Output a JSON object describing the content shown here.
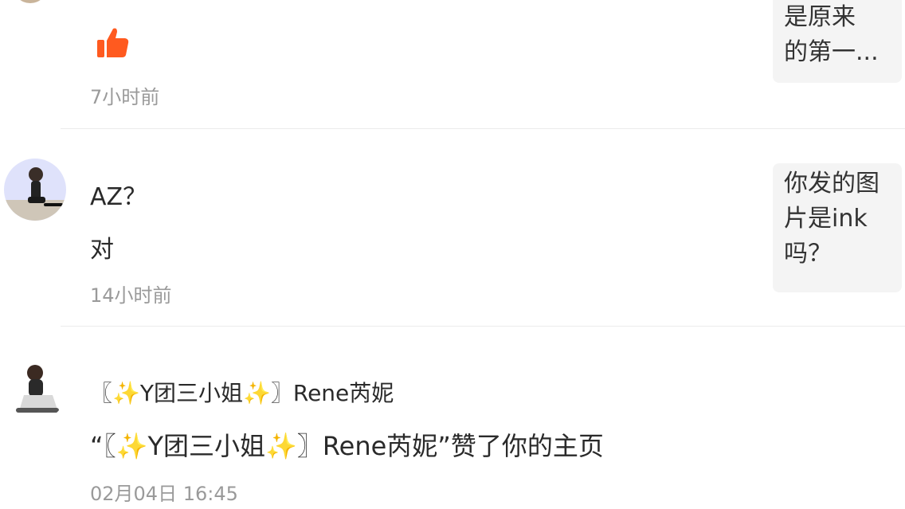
{
  "notifications": [
    {
      "time": "7小时前",
      "quote": "是原来\n的第一..."
    },
    {
      "message": "AZ？",
      "reply": "对",
      "time": "14小时前",
      "quote": "你发的图\n片是ink\n吗？"
    },
    {
      "user_before": "〖",
      "user_name": "Y团三小姐",
      "user_after": "〗Rene芮妮",
      "action_open": "“〖",
      "action_name": "Y团三小姐",
      "action_close": "〗Rene芮妮”赞了你的主页",
      "time": "02月04日 16:45"
    }
  ],
  "colors": {
    "like": "#ff5a1f",
    "time": "#9a9a9a",
    "quote_bg": "#f4f4f4",
    "divider": "#ececec",
    "sparkle": "#f5c518"
  },
  "icons": {
    "like": "thumbs-up-icon",
    "sparkle": "sparkles-icon"
  }
}
